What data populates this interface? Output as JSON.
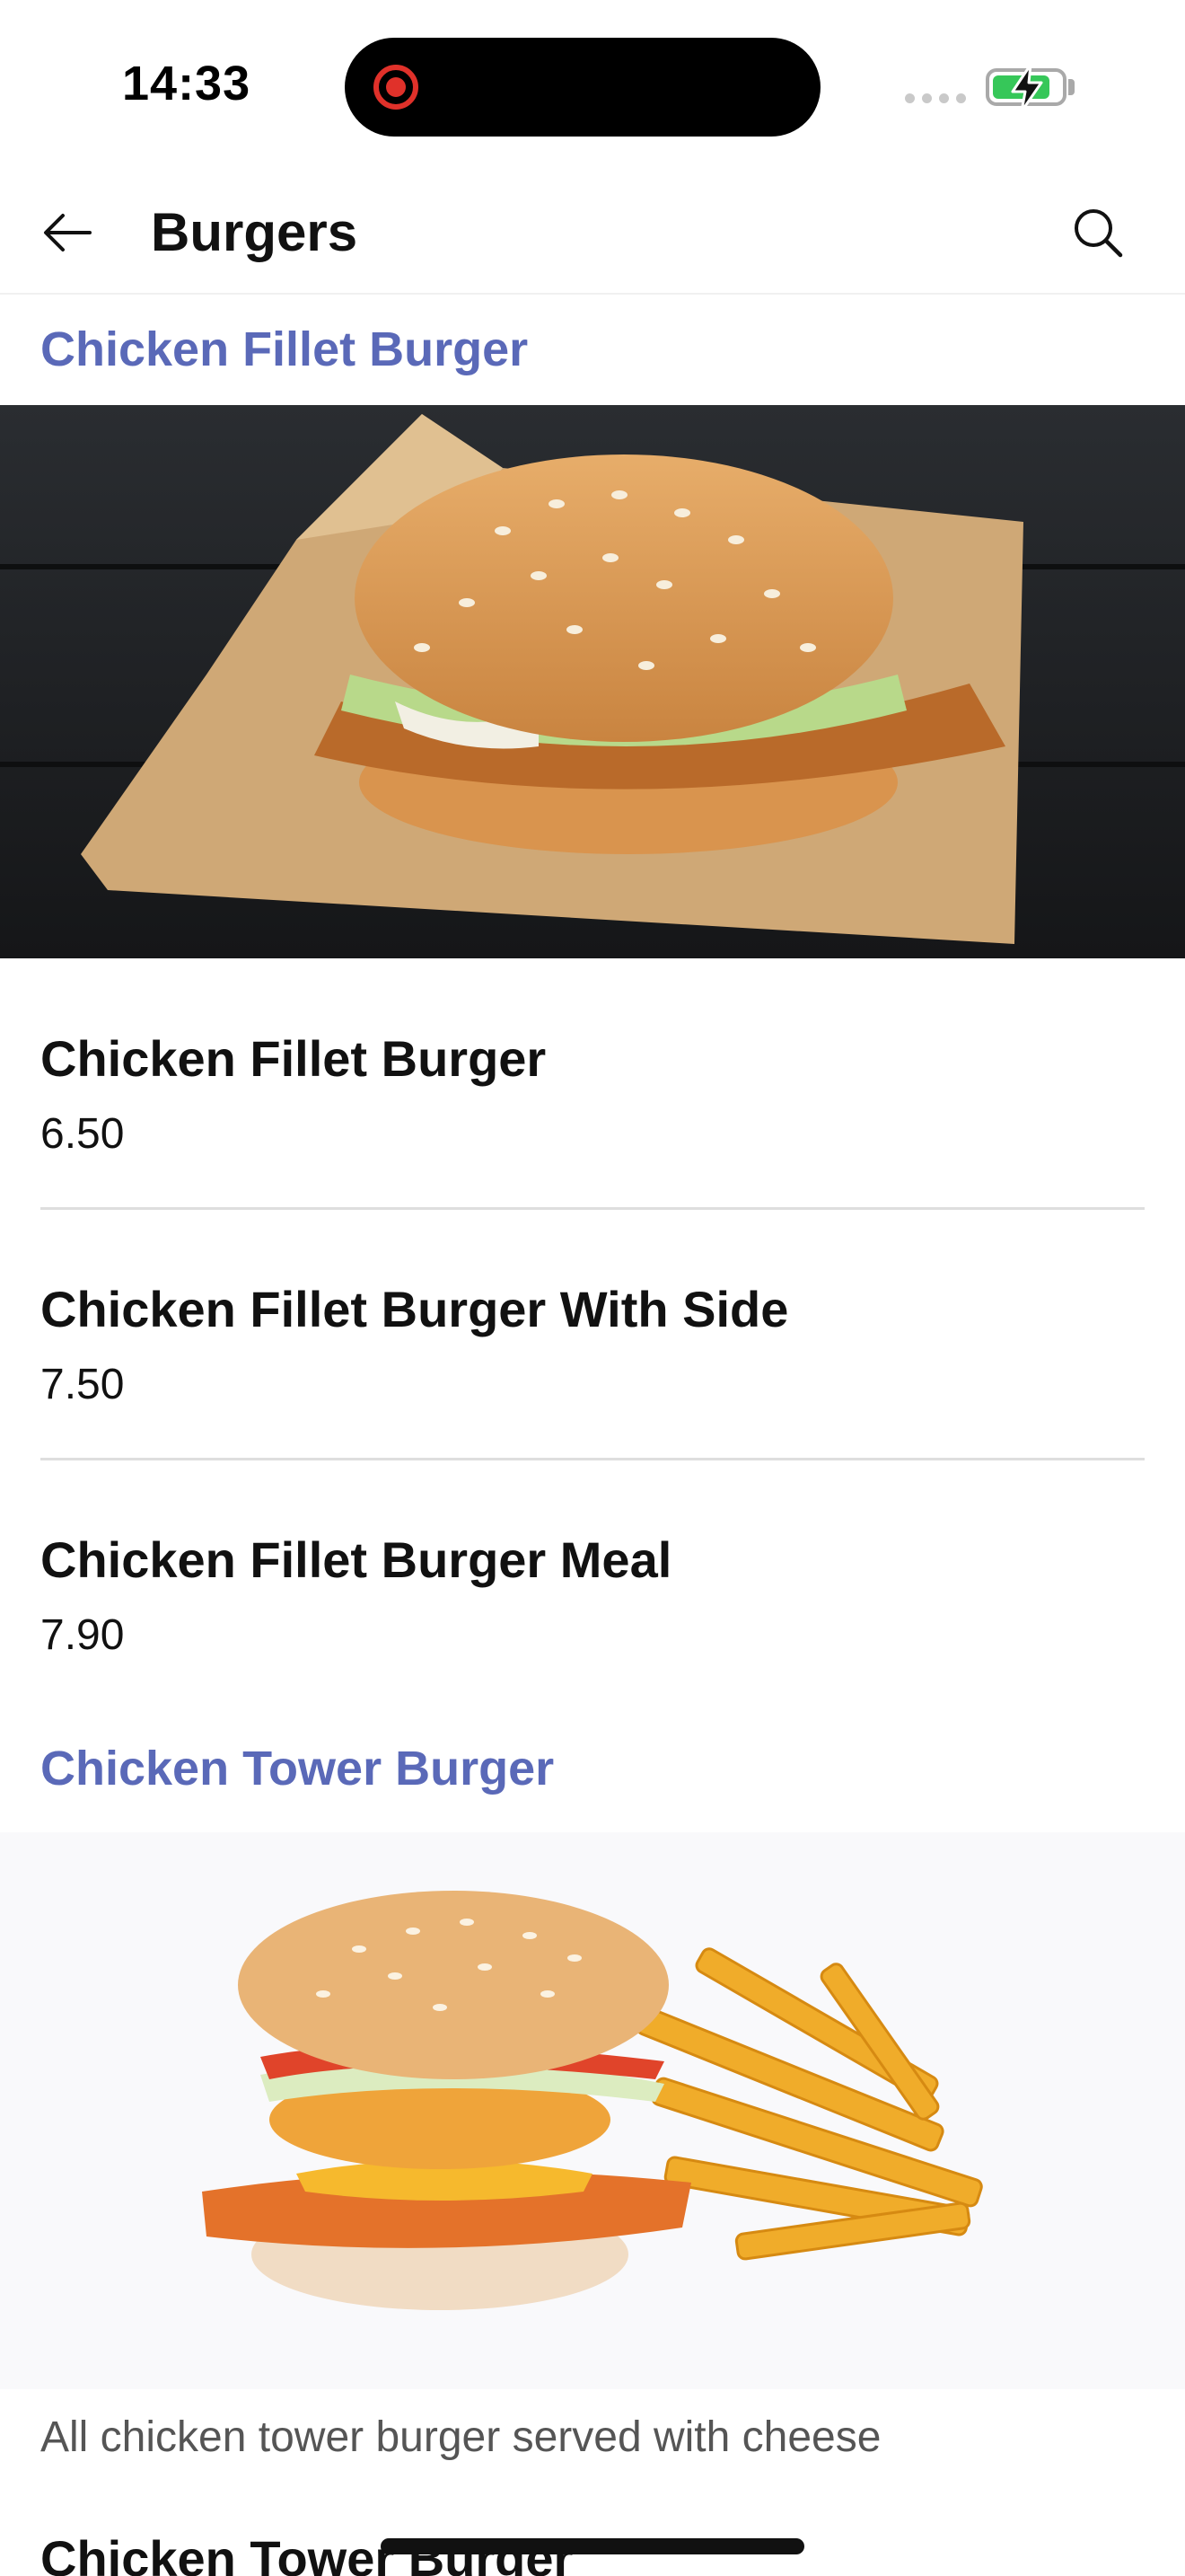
{
  "status_bar": {
    "time": "14:33",
    "battery_level": 0.85,
    "icons": [
      "screen-recording-icon",
      "signal-icon",
      "battery-charging-icon"
    ]
  },
  "header": {
    "title": "Burgers",
    "back_icon": "arrow-left-icon",
    "search_icon": "search-icon"
  },
  "colors": {
    "category_accent": "#5a69b8",
    "battery_green": "#36c759",
    "record_red": "#e0312a"
  },
  "categories": [
    {
      "title": "Chicken Fillet Burger",
      "items": [
        {
          "name": "Chicken Fillet Burger",
          "price": "6.50"
        },
        {
          "name": "Chicken Fillet Burger With Side",
          "price": "7.50"
        },
        {
          "name": "Chicken Fillet Burger Meal",
          "price": "7.90"
        }
      ]
    },
    {
      "title": "Chicken Tower Burger",
      "description": "All chicken tower burger served with cheese",
      "items": [
        {
          "name": "Chicken Tower Burger"
        }
      ]
    }
  ]
}
